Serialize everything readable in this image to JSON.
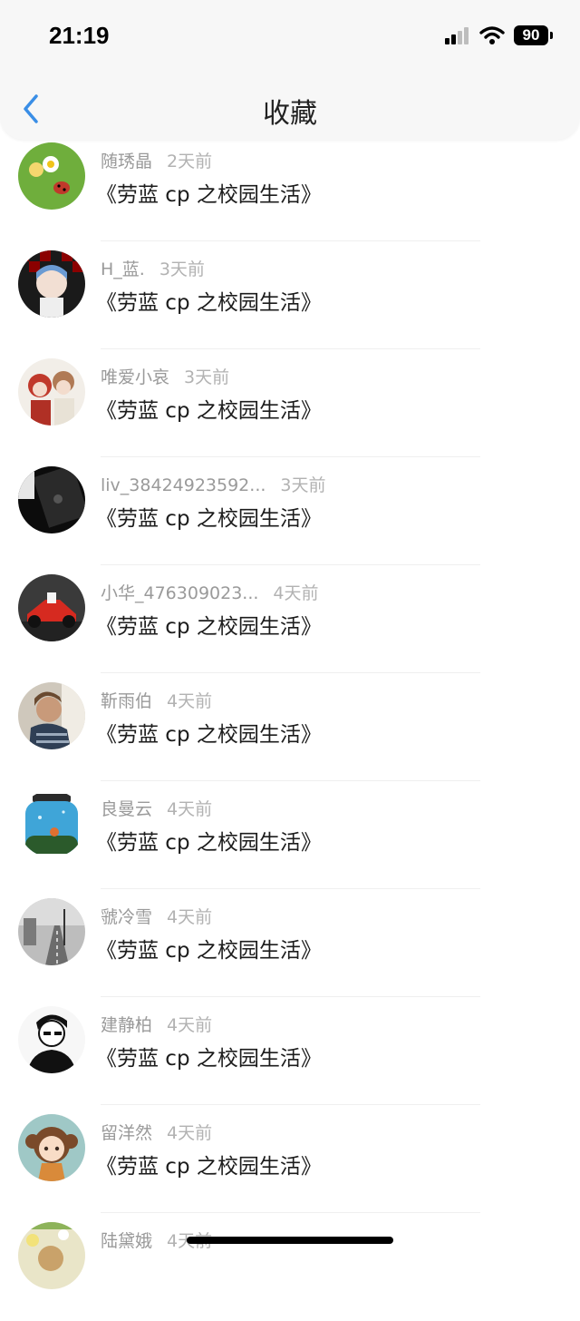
{
  "status_bar": {
    "time": "21:19",
    "battery": "90"
  },
  "header": {
    "title": "收藏"
  },
  "items": [
    {
      "user": "随琇晶",
      "time_ago": "2天前",
      "title": "《劳蓝 cp 之校园生活》"
    },
    {
      "user": "H_蓝.",
      "time_ago": "3天前",
      "title": "《劳蓝 cp 之校园生活》"
    },
    {
      "user": "唯爱小哀",
      "time_ago": "3天前",
      "title": "《劳蓝 cp 之校园生活》"
    },
    {
      "user": "liv_38424923592...",
      "time_ago": "3天前",
      "title": "《劳蓝 cp 之校园生活》"
    },
    {
      "user": "小华_476309023...",
      "time_ago": "4天前",
      "title": "《劳蓝 cp 之校园生活》"
    },
    {
      "user": "靳雨伯",
      "time_ago": "4天前",
      "title": "《劳蓝 cp 之校园生活》"
    },
    {
      "user": "良曼云",
      "time_ago": "4天前",
      "title": "《劳蓝 cp 之校园生活》"
    },
    {
      "user": "虢冷雪",
      "time_ago": "4天前",
      "title": "《劳蓝 cp 之校园生活》"
    },
    {
      "user": "建静柏",
      "time_ago": "4天前",
      "title": "《劳蓝 cp 之校园生活》"
    },
    {
      "user": "留洋然",
      "time_ago": "4天前",
      "title": "《劳蓝 cp 之校园生活》"
    },
    {
      "user": "陆黛娥",
      "time_ago": "4天前",
      "title": ""
    }
  ],
  "colors": {
    "accent": "#3a8ee6"
  },
  "icons": {
    "back": "chevron-left-icon",
    "signal": "signal-icon",
    "wifi": "wifi-icon",
    "battery": "battery-icon"
  }
}
